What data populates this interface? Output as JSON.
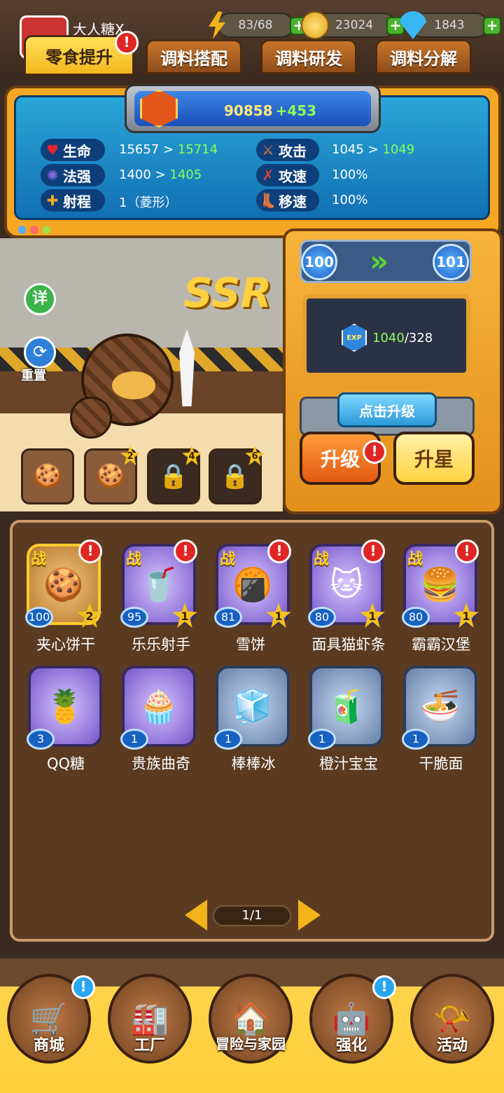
{
  "player": {
    "name": "大人糖X"
  },
  "resources": {
    "energy": "83/68",
    "coins": "23024",
    "gems": "1843"
  },
  "tabs": [
    {
      "label": "零食提升",
      "active": true,
      "badge": "!"
    },
    {
      "label": "调料搭配"
    },
    {
      "label": "调料研发"
    },
    {
      "label": "调料分解"
    }
  ],
  "power": {
    "value": "90858",
    "delta": "+453"
  },
  "stats": {
    "hp": {
      "label": "生命",
      "from": "15657",
      "arrow": ">",
      "to": "15714"
    },
    "atk": {
      "label": "攻击",
      "from": "1045",
      "arrow": ">",
      "to": "1049"
    },
    "mag": {
      "label": "法强",
      "from": "1400",
      "arrow": ">",
      "to": "1405"
    },
    "aspd": {
      "label": "攻速",
      "value": "100%"
    },
    "range": {
      "label": "射程",
      "value": "1（菱形）"
    },
    "mspd": {
      "label": "移速",
      "value": "100%"
    }
  },
  "rarity": "SSR",
  "side_buttons": {
    "detail": "详",
    "reset": "重置"
  },
  "level": {
    "from": "100",
    "to": "101",
    "arrows": "»"
  },
  "exp": {
    "icon": "EXP",
    "current": "1040",
    "required": "/328"
  },
  "click_upgrade": "点击升级",
  "upgrade_button": "升级",
  "upgrade_badge": "!",
  "star_button": "升星",
  "skill_slots": [
    {
      "locked": false,
      "star": ""
    },
    {
      "locked": false,
      "star": "2"
    },
    {
      "locked": true,
      "star": "4"
    },
    {
      "locked": true,
      "star": "6"
    }
  ],
  "snacks": [
    {
      "name": "夹心饼干",
      "level": "100",
      "stars": "2",
      "battle": "战",
      "badge": "!"
    },
    {
      "name": "乐乐射手",
      "level": "95",
      "stars": "1",
      "battle": "战",
      "badge": "!"
    },
    {
      "name": "雪饼",
      "level": "81",
      "stars": "1",
      "battle": "战",
      "badge": "!"
    },
    {
      "name": "面具猫虾条",
      "level": "80",
      "stars": "1",
      "battle": "战",
      "badge": "!"
    },
    {
      "name": "霸霸汉堡",
      "level": "80",
      "stars": "1",
      "battle": "战",
      "badge": "!"
    },
    {
      "name": "QQ糖",
      "level": "3"
    },
    {
      "name": "贵族曲奇",
      "level": "1"
    },
    {
      "name": "棒棒冰",
      "level": "1"
    },
    {
      "name": "橙汁宝宝",
      "level": "1"
    },
    {
      "name": "干脆面",
      "level": "1"
    }
  ],
  "pager": {
    "text": "1/1"
  },
  "nav": [
    {
      "label": "商城",
      "icon": "shop-cart-icon",
      "badge": "!"
    },
    {
      "label": "工厂",
      "icon": "factory-icon"
    },
    {
      "label": "冒险与家园",
      "icon": "adventure-icon"
    },
    {
      "label": "强化",
      "icon": "enhance-icon",
      "badge": "!"
    },
    {
      "label": "活动",
      "icon": "trumpet-icon"
    }
  ]
}
